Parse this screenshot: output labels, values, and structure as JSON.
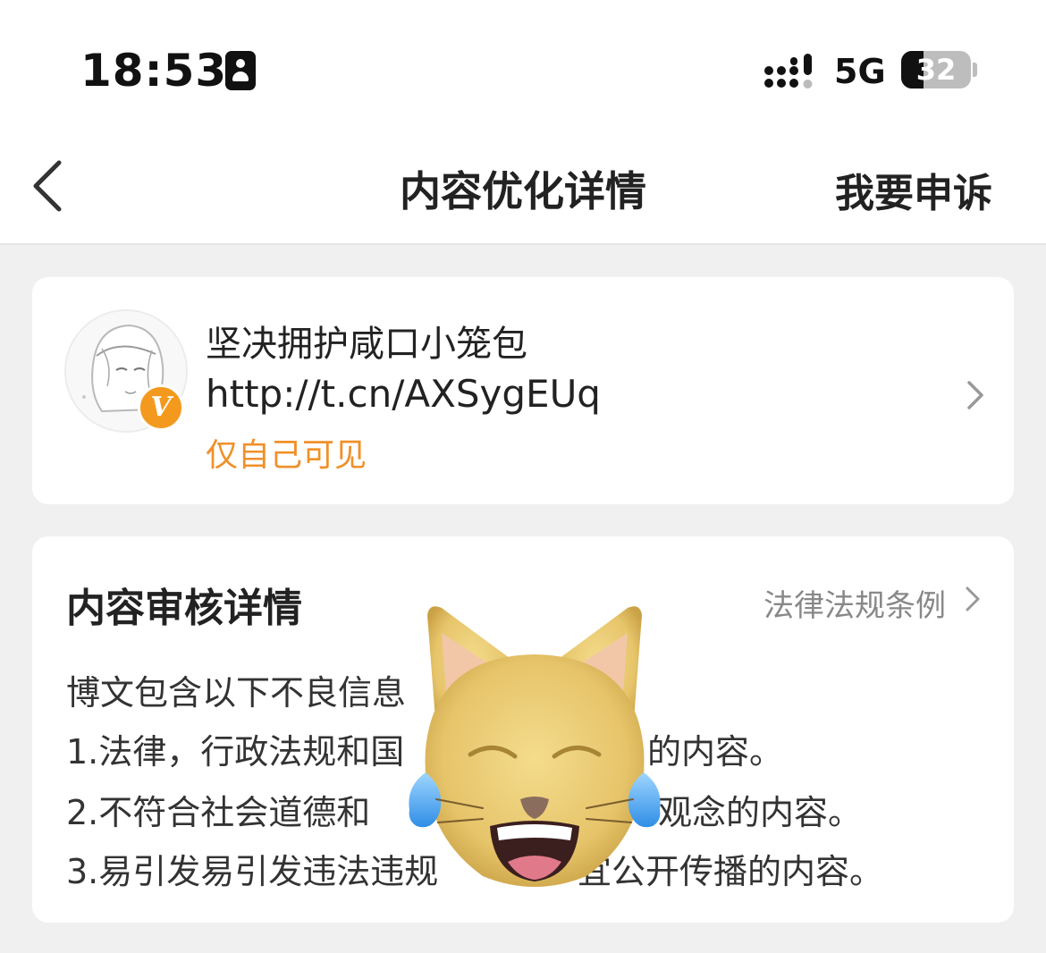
{
  "status_bar": {
    "time": "18:53",
    "network": "5G",
    "battery_level": "32",
    "battery_fraction": 0.32,
    "icons": [
      "portrait-lock-icon",
      "signal-icon",
      "battery-icon"
    ]
  },
  "nav": {
    "title": "内容优化详情",
    "appeal_label": "我要申诉",
    "back_icon": "chevron-left-icon"
  },
  "post": {
    "text": "坚决拥护咸口小笼包",
    "link": "http://t.cn/AXSygEUq",
    "visibility": "仅自己可见",
    "badge": "V",
    "badge_color": "#f39a1e"
  },
  "review": {
    "title": "内容审核详情",
    "law_link": "法律法规条例",
    "lines": [
      "博文包含以下不良信息",
      "1.法律，行政法规和国",
      "的内容。",
      "2.不符合社会道德和",
      "观念的内容。",
      "3.易引发易引发违法违规",
      "宜公开传播的内容。"
    ]
  },
  "colors": {
    "accent_orange": "#f0902a",
    "page_bg": "#f0f0f0",
    "card_bg": "#ffffff"
  }
}
